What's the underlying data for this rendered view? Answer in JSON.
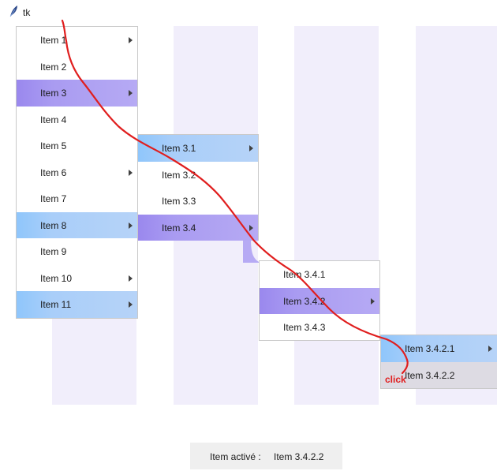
{
  "window": {
    "title": "tk",
    "icon": "feather-icon"
  },
  "menus": [
    {
      "id": "main",
      "items": [
        {
          "label": "Item 1",
          "submenu": true,
          "state": "normal"
        },
        {
          "label": "Item 2",
          "submenu": false,
          "state": "normal"
        },
        {
          "label": "Item 3",
          "submenu": true,
          "state": "active"
        },
        {
          "label": "Item 4",
          "submenu": false,
          "state": "normal"
        },
        {
          "label": "Item 5",
          "submenu": false,
          "state": "normal"
        },
        {
          "label": "Item 6",
          "submenu": true,
          "state": "normal"
        },
        {
          "label": "Item 7",
          "submenu": false,
          "state": "normal"
        },
        {
          "label": "Item 8",
          "submenu": true,
          "state": "hover"
        },
        {
          "label": "Item 9",
          "submenu": false,
          "state": "normal"
        },
        {
          "label": "Item 10",
          "submenu": true,
          "state": "normal"
        },
        {
          "label": "Item 11",
          "submenu": true,
          "state": "hover"
        }
      ]
    },
    {
      "id": "sub-3",
      "items": [
        {
          "label": "Item 3.1",
          "submenu": true,
          "state": "hover"
        },
        {
          "label": "Item 3.2",
          "submenu": false,
          "state": "normal"
        },
        {
          "label": "Item 3.3",
          "submenu": false,
          "state": "normal"
        },
        {
          "label": "Item 3.4",
          "submenu": true,
          "state": "active"
        }
      ]
    },
    {
      "id": "sub-3-4",
      "items": [
        {
          "label": "Item 3.4.1",
          "submenu": false,
          "state": "normal"
        },
        {
          "label": "Item 3.4.2",
          "submenu": true,
          "state": "active"
        },
        {
          "label": "Item 3.4.3",
          "submenu": false,
          "state": "normal"
        }
      ]
    },
    {
      "id": "sub-3-4-2",
      "items": [
        {
          "label": "Item 3.4.2.1",
          "submenu": true,
          "state": "hover"
        },
        {
          "label": "Item 3.4.2.2",
          "submenu": false,
          "state": "pressed"
        }
      ]
    }
  ],
  "status": {
    "label": "Item activé :",
    "value": "Item 3.4.2.2"
  },
  "annotation": {
    "text": "click",
    "color": "#e01e1e"
  },
  "colors": {
    "active": "#9a88ee",
    "hover": "#8fc6fb",
    "pressed": "#dddbe3",
    "column_bg": "#f1eefb",
    "annotation": "#e01e1e"
  }
}
